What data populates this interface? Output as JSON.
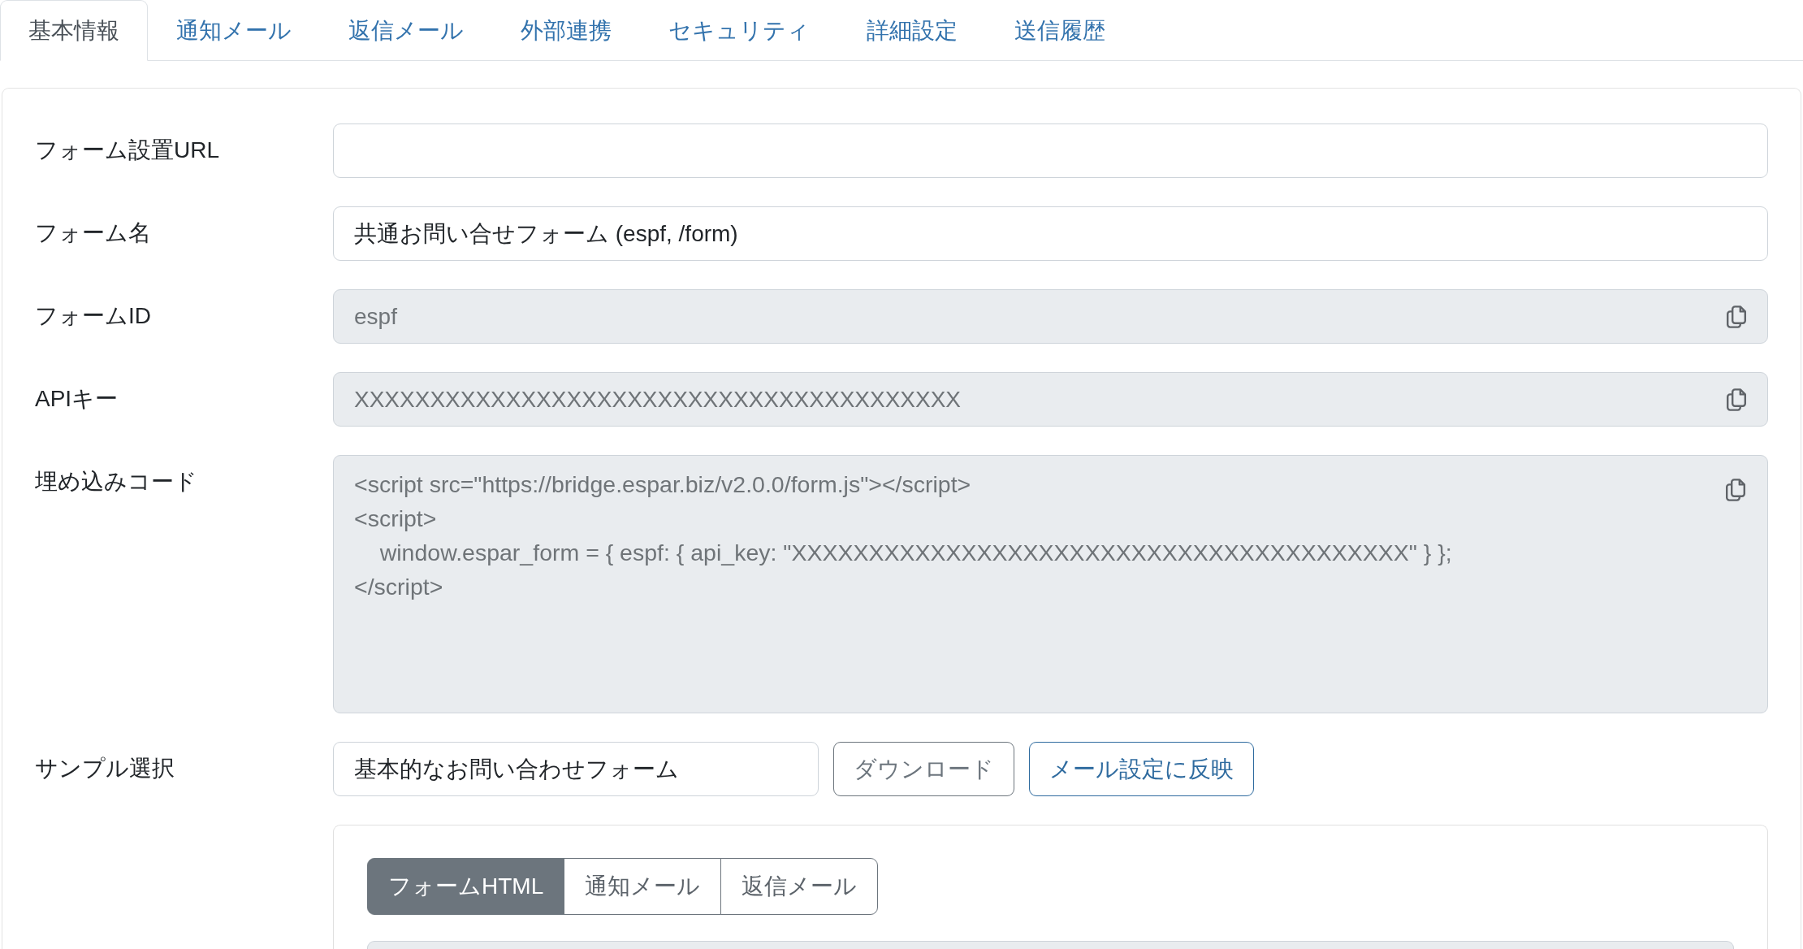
{
  "tabs": [
    {
      "label": "基本情報",
      "selected": true
    },
    {
      "label": "通知メール",
      "selected": false
    },
    {
      "label": "返信メール",
      "selected": false
    },
    {
      "label": "外部連携",
      "selected": false
    },
    {
      "label": "セキュリティ",
      "selected": false
    },
    {
      "label": "詳細設定",
      "selected": false
    },
    {
      "label": "送信履歴",
      "selected": false
    }
  ],
  "fields": [
    {
      "kind": "input",
      "label": "フォーム設置URL",
      "disabled": false,
      "copyable": false
    },
    {
      "kind": "input",
      "label": "フォーム名",
      "value": "共通お問い合せフォーム (espf, /form)",
      "disabled": false,
      "copyable": false
    },
    {
      "kind": "input",
      "label": "フォームID",
      "value": "espf",
      "disabled": true,
      "copyable": true
    },
    {
      "kind": "input",
      "label": "APIキー",
      "value": "XXXXXXXXXXXXXXXXXXXXXXXXXXXXXXXXXXXXXXXX",
      "disabled": true,
      "copyable": true
    },
    {
      "kind": "code",
      "label": "埋め込みコード",
      "lines": [
        "<script src=\"https://bridge.espar.biz/v2.0.0/form.js\"></script>",
        "<script>",
        "    window.espar_form = { espf: { api_key: \"XXXXXXXXXXXXXXXXXXXXXXXXXXXXXXXXXXXXXXXX\" } };",
        "</script>"
      ],
      "disabled": true,
      "copyable": true
    }
  ],
  "sample": {
    "label": "サンプル選択",
    "value": "基本的なお問い合わせフォーム",
    "buttons": [
      {
        "label": "ダウンロード",
        "kind": "secondary"
      },
      {
        "label": "メール設定に反映",
        "kind": "primary"
      }
    ],
    "preview_tabs": [
      {
        "label": "フォームHTML",
        "selected": true
      },
      {
        "label": "通知メール",
        "selected": false
      },
      {
        "label": "返信メール",
        "selected": false
      }
    ]
  }
}
